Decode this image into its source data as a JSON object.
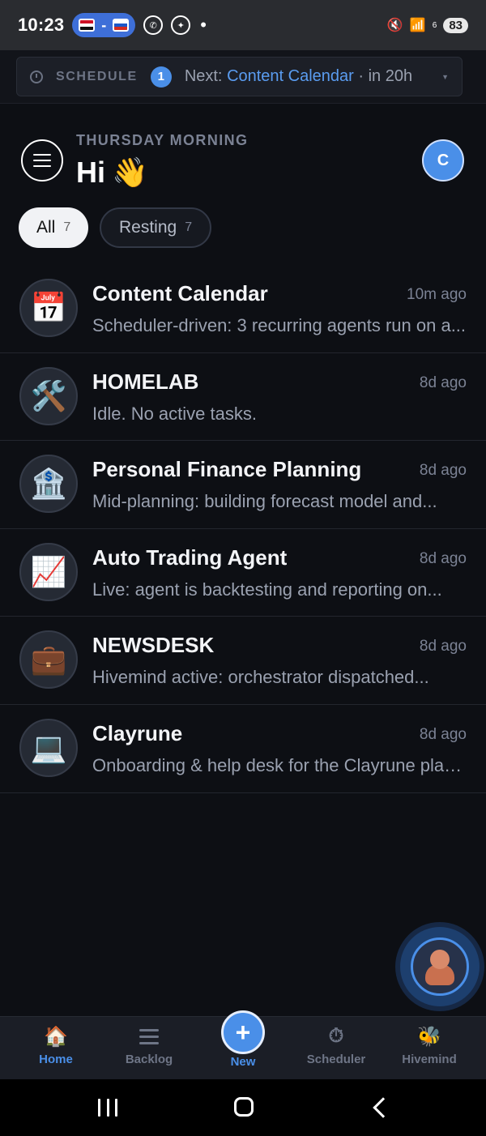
{
  "status_bar": {
    "time": "10:23",
    "dash": "-",
    "signal_superscript": "6",
    "battery": "83"
  },
  "schedule": {
    "label": "SCHEDULE",
    "count": "1",
    "next_prefix": "Next: ",
    "next_name": "Content Calendar",
    "next_suffix": " · in 20h"
  },
  "header": {
    "subtitle": "THURSDAY MORNING",
    "greeting": "Hi",
    "greeting_emoji": "👋",
    "avatar_initial": "C"
  },
  "filters": [
    {
      "label": "All",
      "count": "7",
      "active": true
    },
    {
      "label": "Resting",
      "count": "7",
      "active": false
    }
  ],
  "projects": [
    {
      "icon": "calendar-icon",
      "glyph": "📅",
      "title": "Content Calendar",
      "time": "10m ago",
      "subtitle": "Scheduler-driven: 3 recurring agents run on a..."
    },
    {
      "icon": "tools-icon",
      "glyph": "🛠️",
      "title": "HOMELAB",
      "time": "8d ago",
      "subtitle": "Idle. No active tasks."
    },
    {
      "icon": "bank-icon",
      "glyph": "🏦",
      "title": "Personal Finance Planning",
      "time": "8d ago",
      "subtitle": "Mid-planning: building forecast model and..."
    },
    {
      "icon": "chart-up-icon",
      "glyph": "📈",
      "title": "Auto Trading Agent",
      "time": "8d ago",
      "subtitle": "Live: agent is backtesting and reporting on..."
    },
    {
      "icon": "briefcase-icon",
      "glyph": "💼",
      "title": "NEWSDESK",
      "time": "8d ago",
      "subtitle": "Hivemind active: orchestrator dispatched..."
    },
    {
      "icon": "laptop-icon",
      "glyph": "💻",
      "title": "Clayrune",
      "time": "8d ago",
      "subtitle": "Onboarding & help desk for the Clayrune platform..."
    }
  ],
  "nav": {
    "home": "Home",
    "backlog": "Backlog",
    "new": "New",
    "new_glyph": "+",
    "scheduler": "Scheduler",
    "hivemind": "Hivemind",
    "home_glyph": "🏠",
    "scheduler_glyph": "⏱",
    "hivemind_glyph": "🐝"
  },
  "colors": {
    "accent": "#4a8fe8",
    "background": "#0d0f14",
    "chip_active_bg": "#f1f2f5"
  }
}
